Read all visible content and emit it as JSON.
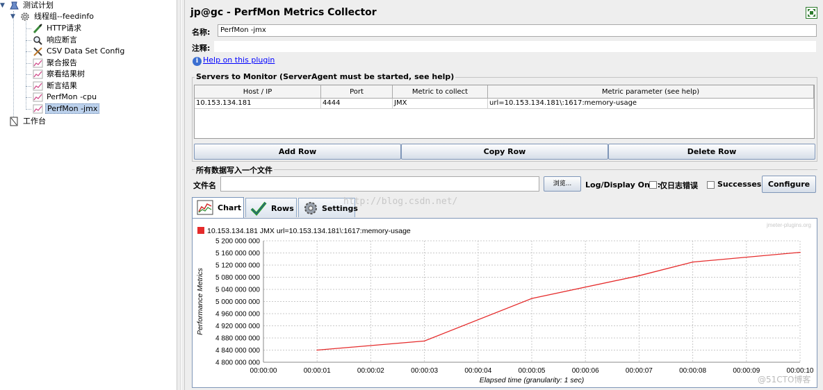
{
  "tree": {
    "items": [
      {
        "label": "测试计划",
        "icon": "test-plan-icon"
      },
      {
        "label": "线程组--feedinfo",
        "icon": "thread-group-gear-icon"
      },
      {
        "label": "HTTP请求",
        "icon": "pipette-icon"
      },
      {
        "label": "响应断言",
        "icon": "magnifier-icon"
      },
      {
        "label": "CSV Data Set Config",
        "icon": "tools-icon"
      },
      {
        "label": "聚合报告",
        "icon": "graph-icon"
      },
      {
        "label": "察看结果树",
        "icon": "graph-icon"
      },
      {
        "label": "断言结果",
        "icon": "graph-icon"
      },
      {
        "label": "PerfMon -cpu",
        "icon": "graph-icon"
      },
      {
        "label": "PerfMon -jmx",
        "icon": "graph-icon"
      },
      {
        "label": "工作台",
        "icon": "workbench-icon"
      }
    ]
  },
  "header": {
    "title": "jp@gc - PerfMon Metrics Collector",
    "name_label": "名称:",
    "name_value": "PerfMon -jmx",
    "comment_label": "注释:",
    "help_link": "Help on this plugin"
  },
  "servers": {
    "group_title": "Servers to Monitor (ServerAgent must be started, see help)",
    "columns": [
      "Host / IP",
      "Port",
      "Metric to collect",
      "Metric parameter (see help)"
    ],
    "rows": [
      [
        "10.153.134.181",
        "4444",
        "JMX",
        "url=10.153.134.181\\:1617:memory-usage"
      ]
    ],
    "buttons": {
      "add": "Add Row",
      "copy": "Copy Row",
      "delete": "Delete Row"
    }
  },
  "file_section": {
    "group_title": "所有数据写入一个文件",
    "file_label": "文件名",
    "file_value": "",
    "browse": "浏览...",
    "display_label": "Log/Display Only:",
    "errors_only": "仅日志错误",
    "successes": "Successes",
    "configure": "Configure"
  },
  "tabs": [
    {
      "label": "Chart",
      "icon": "chart-icon",
      "active": true
    },
    {
      "label": "Rows",
      "icon": "checkmark-icon",
      "active": false
    },
    {
      "label": "Settings",
      "icon": "settings-gear-icon",
      "active": false
    }
  ],
  "watermark": "http://blog.csdn.net/",
  "corner_mark": "@51CTO博客",
  "colors": {
    "series": "#e52b2b",
    "accent": "#7f96b8"
  },
  "chart_data": {
    "type": "line",
    "legend": "10.153.134.181 JMX url=10.153.134.181\\:1617:memory-usage",
    "brand": "jmeter-plugins.org",
    "xlabel": "Elapsed time (granularity: 1 sec)",
    "ylabel": "Performance Metrics",
    "x_ticks": [
      "00:00:00",
      "00:00:01",
      "00:00:02",
      "00:00:03",
      "00:00:04",
      "00:00:05",
      "00:00:06",
      "00:00:07",
      "00:00:08",
      "00:00:09",
      "00:00:10"
    ],
    "y_ticks": [
      "4 800 000 000",
      "4 840 000 000",
      "4 880 000 000",
      "4 920 000 000",
      "4 960 000 000",
      "5 000 000 000",
      "5 040 000 000",
      "5 080 000 000",
      "5 120 000 000",
      "5 160 000 000",
      "5 200 000 000"
    ],
    "ylim": [
      4800000000,
      5200000000
    ],
    "xlim": [
      0,
      10
    ],
    "grid": true,
    "series": [
      {
        "name": "10.153.134.181 JMX url=10.153.134.181\\:1617:memory-usage",
        "x": [
          1,
          3,
          5,
          7,
          8,
          10
        ],
        "y": [
          4840000000,
          4870000000,
          5010000000,
          5085000000,
          5130000000,
          5162000000
        ]
      }
    ]
  }
}
